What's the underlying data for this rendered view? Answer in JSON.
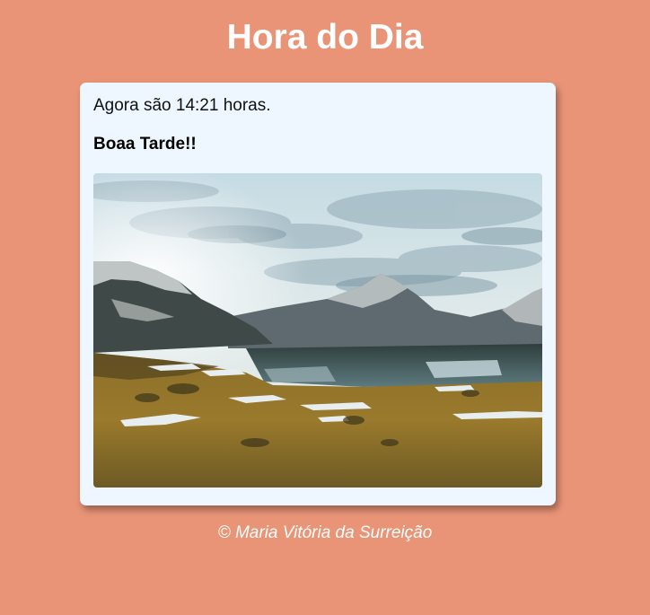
{
  "page": {
    "title": "Hora do Dia"
  },
  "card": {
    "time_message": "Agora são 14:21 horas.",
    "greeting": "Boaa Tarde!!",
    "image_icon": "landscape-photo"
  },
  "footer": {
    "credit": "© Maria Vitória da Surreição"
  },
  "colors": {
    "background": "#e99477",
    "card_background": "#eef6ff",
    "title_text": "#ffffff"
  }
}
